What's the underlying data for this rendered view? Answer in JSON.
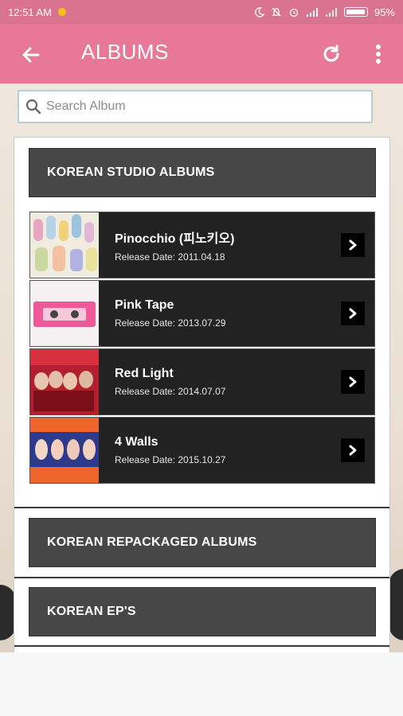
{
  "status_bar": {
    "time": "12:51 AM",
    "battery": "95%"
  },
  "app_bar": {
    "title": "ALBUMS"
  },
  "search": {
    "placeholder": "Search Album"
  },
  "sections": [
    {
      "label": "KOREAN STUDIO ALBUMS"
    },
    {
      "label": "KOREAN REPACKAGED ALBUMS"
    },
    {
      "label": "KOREAN EP'S"
    }
  ],
  "albums": [
    {
      "name": "Pinocchio (피노키오)",
      "release": "Release Date: 2011.04.18"
    },
    {
      "name": "Pink Tape",
      "release": "Release Date: 2013.07.29"
    },
    {
      "name": "Red Light",
      "release": "Release Date: 2014.07.07"
    },
    {
      "name": "4 Walls",
      "release": "Release Date: 2015.10.27"
    }
  ],
  "colors": {
    "status_bar": "#d9738f",
    "app_bar": "#e77898",
    "section_header": "#474747",
    "album_row": "#222222"
  }
}
